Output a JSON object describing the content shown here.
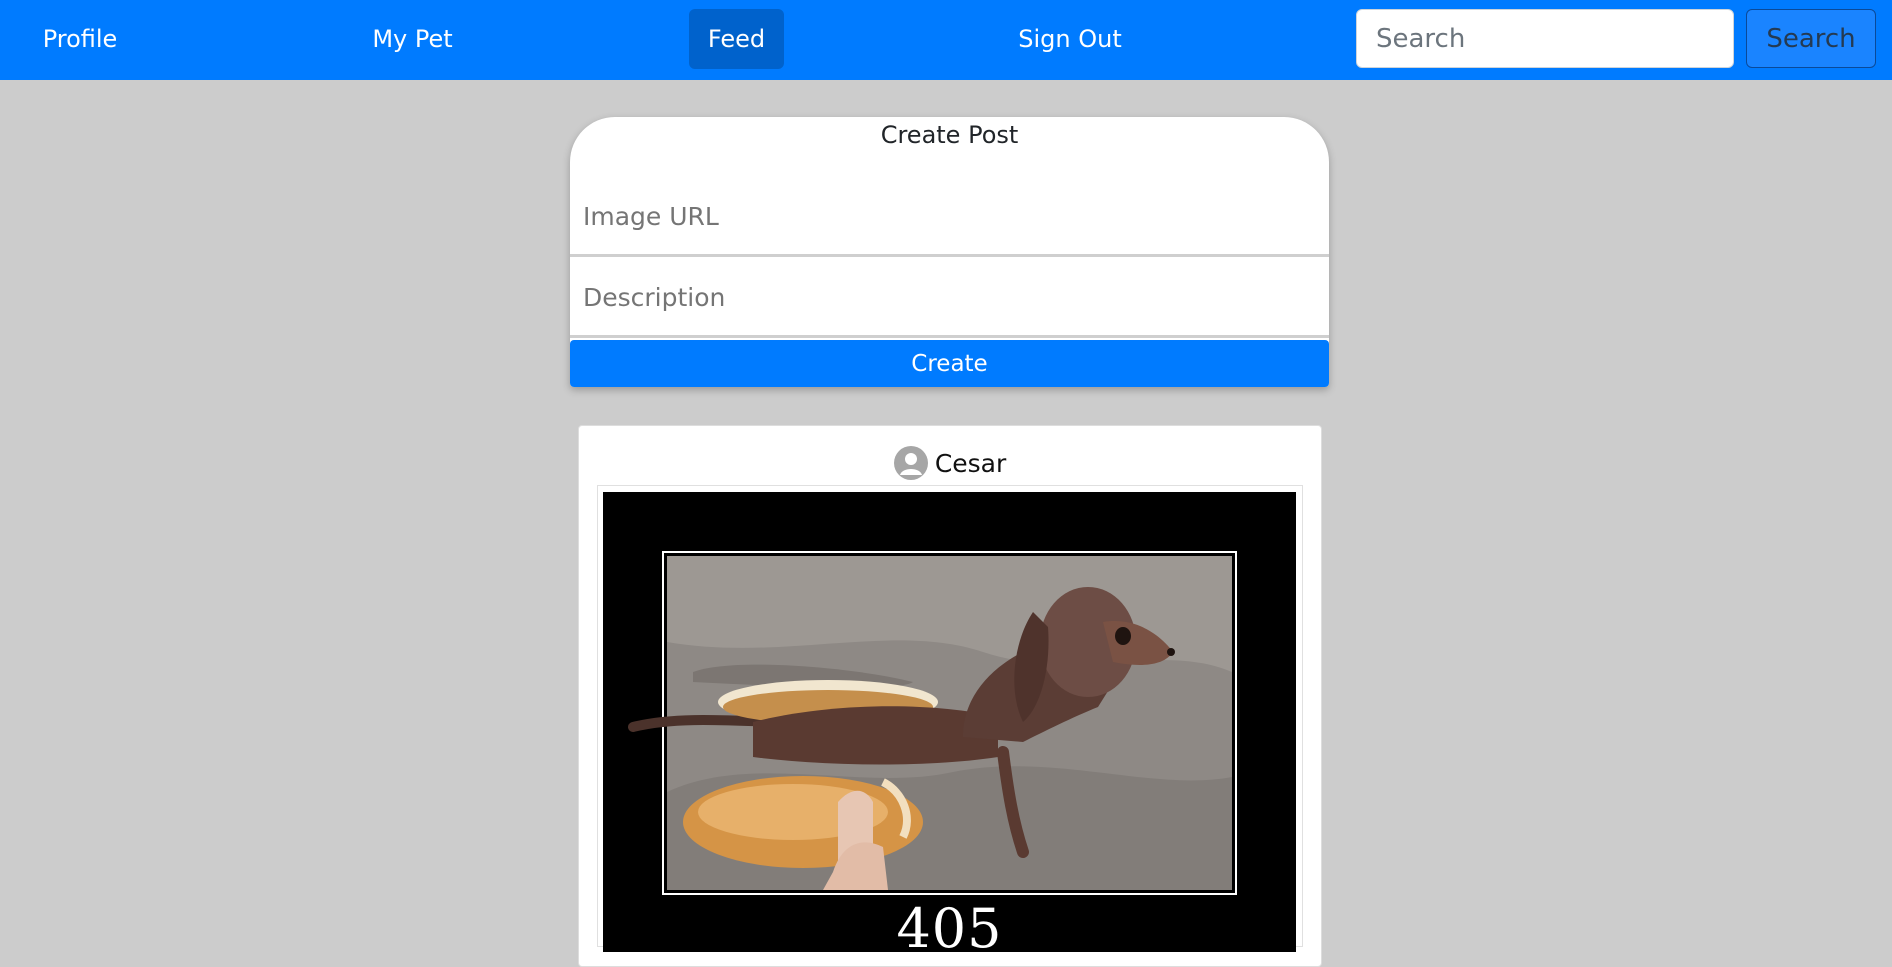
{
  "navbar": {
    "items": [
      {
        "label": "Profile",
        "active": false
      },
      {
        "label": "My Pet",
        "active": false
      },
      {
        "label": "Feed",
        "active": true
      },
      {
        "label": "Sign Out",
        "active": false
      }
    ],
    "search_placeholder": "Search",
    "search_button_label": "Search",
    "brand_color": "#007bff"
  },
  "create_post": {
    "title": "Create Post",
    "image_url_placeholder": "Image URL",
    "description_placeholder": "Description",
    "create_button_label": "Create"
  },
  "feed": {
    "posts": [
      {
        "username": "Cesar",
        "avatar_icon": "user-icon",
        "image_caption": "405"
      }
    ]
  }
}
